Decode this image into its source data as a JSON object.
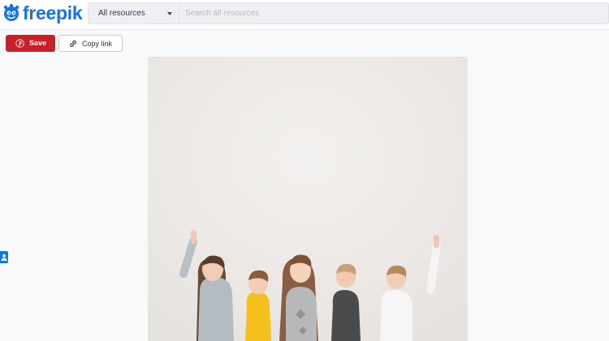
{
  "header": {
    "logo_text": "freepik",
    "logo_icon": "freepik-logo-icon"
  },
  "search": {
    "filter_label": "All resources",
    "filter_icon": "caret-down-icon",
    "placeholder": "Search all resources",
    "value": ""
  },
  "actions": {
    "save_label": "Save",
    "save_icon": "pinterest-icon",
    "copy_label": "Copy link",
    "copy_icon": "link-icon"
  },
  "side_tab": {
    "icon": "person-icon"
  },
  "colors": {
    "brand": "#1273eb",
    "save": "#cb1f27"
  }
}
